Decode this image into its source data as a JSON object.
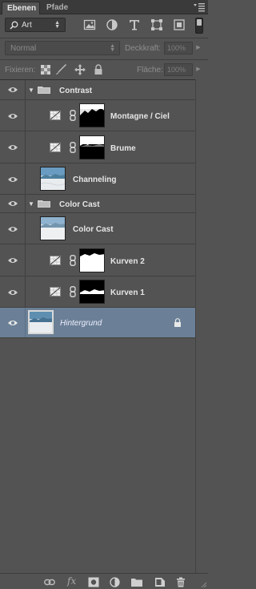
{
  "tabs": [
    {
      "label": "Ebenen",
      "active": true
    },
    {
      "label": "Pfade",
      "active": false
    }
  ],
  "filter": {
    "kind_label": "Art",
    "search_icon": "search-icon"
  },
  "filter_icons": [
    "pixel-filter-icon",
    "adjustment-filter-icon",
    "type-filter-icon",
    "shape-filter-icon",
    "smart-object-filter-icon"
  ],
  "blend": {
    "mode": "Normal",
    "opacity_label": "Deckkraft:",
    "opacity_value": "100%"
  },
  "lock": {
    "label": "Fixieren:",
    "fill_label": "Fläche:",
    "fill_value": "100%",
    "icons": [
      "lock-transparent-icon",
      "lock-image-icon",
      "lock-position-icon",
      "lock-all-icon"
    ]
  },
  "layers": [
    {
      "kind": "group",
      "name": "Contrast",
      "indent": 0
    },
    {
      "kind": "adjustment",
      "name": "Montagne / Ciel",
      "indent": 1,
      "mask": "mountain-top"
    },
    {
      "kind": "adjustment",
      "name": "Brume",
      "indent": 1,
      "mask": "mountain-mid"
    },
    {
      "kind": "image",
      "name": "Channeling",
      "indent": 1
    },
    {
      "kind": "group",
      "name": "Color Cast",
      "indent": 0
    },
    {
      "kind": "image",
      "name": "Color Cast",
      "indent": 1
    },
    {
      "kind": "adjustment",
      "name": "Kurven 2",
      "indent": 1,
      "mask": "white-sky"
    },
    {
      "kind": "adjustment",
      "name": "Kurven 1",
      "indent": 1,
      "mask": "white-bottom"
    },
    {
      "kind": "background",
      "name": "Hintergrund",
      "indent": 0,
      "selected": true,
      "locked": true
    }
  ],
  "bottom_icons": [
    "link-layers-icon",
    "fx-icon",
    "add-mask-icon",
    "adjustment-layer-icon",
    "new-group-icon",
    "new-layer-icon",
    "trash-icon"
  ],
  "colors": {
    "panel": "#535353",
    "selected": "#6b8096",
    "tab_bar": "#3a3a3a"
  }
}
